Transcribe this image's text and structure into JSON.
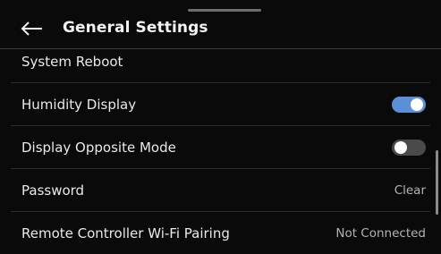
{
  "header": {
    "title": "General Settings",
    "back_icon": "arrow-left-icon"
  },
  "settings": {
    "system_reboot": {
      "label": "System Reboot"
    },
    "humidity_display": {
      "label": "Humidity Display",
      "enabled": true
    },
    "display_opposite_mode": {
      "label": "Display Opposite Mode",
      "enabled": false
    },
    "password": {
      "label": "Password",
      "value": "Clear"
    },
    "remote_wifi_pairing": {
      "label": "Remote Controller Wi-Fi Pairing",
      "value": "Not Connected"
    }
  },
  "colors": {
    "background": "#0a0a0a",
    "toggle_on": "#5b8fd6",
    "toggle_off": "#4a4a4a"
  }
}
